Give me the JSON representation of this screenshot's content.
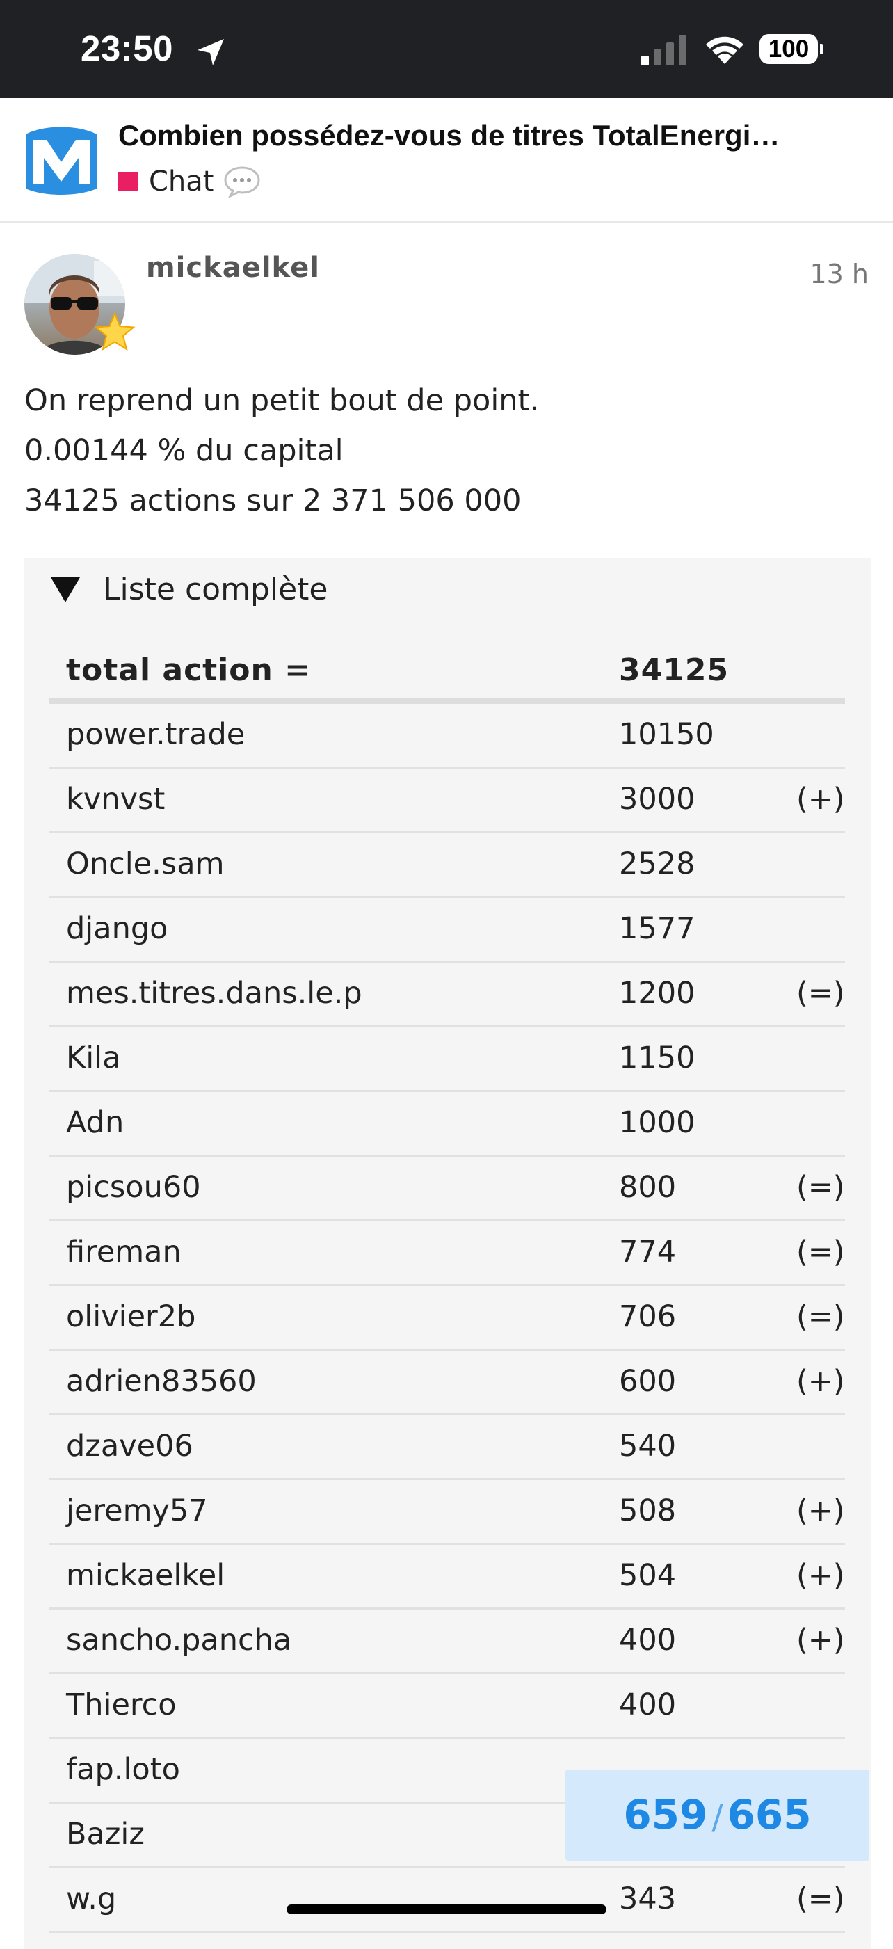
{
  "status_bar": {
    "time": "23:50",
    "battery": "100"
  },
  "header": {
    "topic_title": "Combien possédez-vous de titres TotalEnergi…",
    "category": {
      "label": "Chat",
      "color": "#e91e63"
    }
  },
  "post": {
    "username": "mickaelkel",
    "time": "13 h",
    "lines": [
      "On reprend un petit bout de point.",
      "0.00144 % du capital",
      "34125 actions sur 2 371 506 000"
    ]
  },
  "details": {
    "summary": "Liste complète",
    "header": {
      "name": "total action =",
      "value": "34125"
    },
    "rows": [
      {
        "name": "power.trade",
        "value": "10150",
        "mark": ""
      },
      {
        "name": "kvnvst",
        "value": "3000",
        "mark": "(+)"
      },
      {
        "name": "Oncle.sam",
        "value": "2528",
        "mark": ""
      },
      {
        "name": "django",
        "value": "1577",
        "mark": ""
      },
      {
        "name": "mes.titres.dans.le.p",
        "value": "1200",
        "mark": "(=)"
      },
      {
        "name": "Kila",
        "value": "1150",
        "mark": ""
      },
      {
        "name": "Adn",
        "value": "1000",
        "mark": ""
      },
      {
        "name": "picsou60",
        "value": "800",
        "mark": "(=)"
      },
      {
        "name": "fireman",
        "value": "774",
        "mark": "(=)"
      },
      {
        "name": "olivier2b",
        "value": "706",
        "mark": "(=)"
      },
      {
        "name": "adrien83560",
        "value": "600",
        "mark": "(+)"
      },
      {
        "name": "dzave06",
        "value": "540",
        "mark": ""
      },
      {
        "name": "jeremy57",
        "value": "508",
        "mark": "(+)"
      },
      {
        "name": "mickaelkel",
        "value": "504",
        "mark": "(+)"
      },
      {
        "name": "sancho.pancha",
        "value": "400",
        "mark": "(+)"
      },
      {
        "name": "Thierco",
        "value": "400",
        "mark": ""
      },
      {
        "name": "fap.loto",
        "value": "",
        "mark": ""
      },
      {
        "name": "Baziz",
        "value": "",
        "mark": ""
      },
      {
        "name": "w.g",
        "value": "343",
        "mark": "(=)"
      }
    ]
  },
  "progress": {
    "current": "659",
    "separator": "/",
    "total": "665"
  },
  "colors": {
    "accent": "#1e88e5",
    "progress_bg": "#d4e9fb",
    "status_bar_bg": "#202125"
  }
}
